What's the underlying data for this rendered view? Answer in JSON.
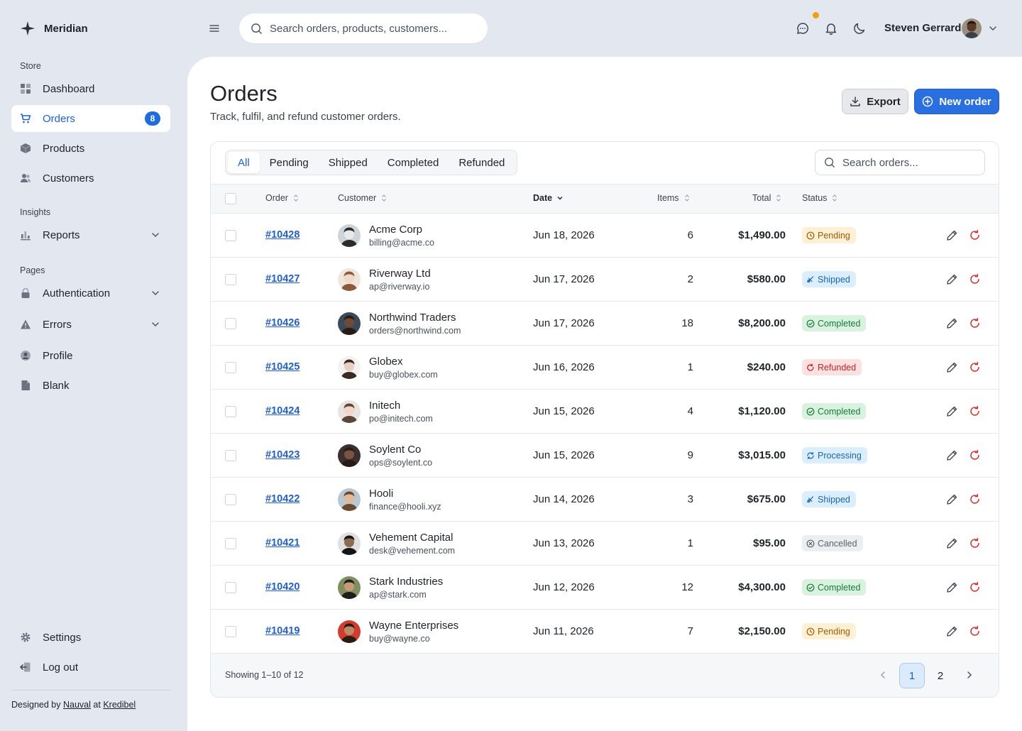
{
  "brand": {
    "name": "Meridian"
  },
  "sidebar": {
    "sections": {
      "store": "Store",
      "insights": "Insights",
      "pages": "Pages"
    },
    "items": [
      {
        "label": "Dashboard",
        "icon": "grid-icon"
      },
      {
        "label": "Orders",
        "icon": "cart-icon",
        "badge": "8",
        "active": true
      },
      {
        "label": "Products",
        "icon": "box-icon"
      },
      {
        "label": "Customers",
        "icon": "users-icon"
      },
      {
        "label": "Reports",
        "icon": "bar-chart-icon",
        "expandable": true
      },
      {
        "label": "Authentication",
        "icon": "lock-icon",
        "expandable": true
      },
      {
        "label": "Errors",
        "icon": "warning-icon",
        "expandable": true
      },
      {
        "label": "Profile",
        "icon": "user-circle-icon"
      },
      {
        "label": "Blank",
        "icon": "file-icon"
      },
      {
        "label": "Settings",
        "icon": "gear-icon"
      },
      {
        "label": "Log out",
        "icon": "logout-icon"
      }
    ],
    "credit": {
      "prefix": "Designed by",
      "author": "Nauval",
      "at": "at",
      "company": "Kredibel"
    }
  },
  "topbar": {
    "search_placeholder": "Search orders, products, customers...",
    "user_name": "Steven Gerrard"
  },
  "page": {
    "title": "Orders",
    "subtitle": "Track, fulfil, and refund customer orders.",
    "export_label": "Export",
    "new_order_label": "New order"
  },
  "filters": {
    "tabs": [
      "All",
      "Pending",
      "Shipped",
      "Completed",
      "Refunded"
    ],
    "active_tab": "All",
    "search_placeholder": "Search orders..."
  },
  "table": {
    "columns": {
      "order": "Order",
      "customer": "Customer",
      "date": "Date",
      "items": "Items",
      "total": "Total",
      "status": "Status"
    },
    "rows": [
      {
        "order": "#10428",
        "customer": "Acme Corp",
        "email": "billing@acme.co",
        "date": "Jun 18, 2026",
        "items": "6",
        "total": "$1,490.00",
        "status": "Pending",
        "status_key": "pending"
      },
      {
        "order": "#10427",
        "customer": "Riverway Ltd",
        "email": "ap@riverway.io",
        "date": "Jun 17, 2026",
        "items": "2",
        "total": "$580.00",
        "status": "Shipped",
        "status_key": "shipped"
      },
      {
        "order": "#10426",
        "customer": "Northwind Traders",
        "email": "orders@northwind.com",
        "date": "Jun 17, 2026",
        "items": "18",
        "total": "$8,200.00",
        "status": "Completed",
        "status_key": "completed"
      },
      {
        "order": "#10425",
        "customer": "Globex",
        "email": "buy@globex.com",
        "date": "Jun 16, 2026",
        "items": "1",
        "total": "$240.00",
        "status": "Refunded",
        "status_key": "refunded"
      },
      {
        "order": "#10424",
        "customer": "Initech",
        "email": "po@initech.com",
        "date": "Jun 15, 2026",
        "items": "4",
        "total": "$1,120.00",
        "status": "Completed",
        "status_key": "completed"
      },
      {
        "order": "#10423",
        "customer": "Soylent Co",
        "email": "ops@soylent.co",
        "date": "Jun 15, 2026",
        "items": "9",
        "total": "$3,015.00",
        "status": "Processing",
        "status_key": "processing"
      },
      {
        "order": "#10422",
        "customer": "Hooli",
        "email": "finance@hooli.xyz",
        "date": "Jun 14, 2026",
        "items": "3",
        "total": "$675.00",
        "status": "Shipped",
        "status_key": "shipped"
      },
      {
        "order": "#10421",
        "customer": "Vehement Capital",
        "email": "desk@vehement.com",
        "date": "Jun 13, 2026",
        "items": "1",
        "total": "$95.00",
        "status": "Cancelled",
        "status_key": "cancelled"
      },
      {
        "order": "#10420",
        "customer": "Stark Industries",
        "email": "ap@stark.com",
        "date": "Jun 12, 2026",
        "items": "12",
        "total": "$4,300.00",
        "status": "Completed",
        "status_key": "completed"
      },
      {
        "order": "#10419",
        "customer": "Wayne Enterprises",
        "email": "buy@wayne.co",
        "date": "Jun 11, 2026",
        "items": "7",
        "total": "$2,150.00",
        "status": "Pending",
        "status_key": "pending"
      }
    ]
  },
  "pagination": {
    "showing": "Showing 1–10 of 12",
    "pages": [
      "1",
      "2"
    ],
    "current": "1"
  },
  "colors": {
    "accent": "#2a6fe0",
    "background": "#e3e8f0",
    "notification_dot": "#f59e0b"
  }
}
